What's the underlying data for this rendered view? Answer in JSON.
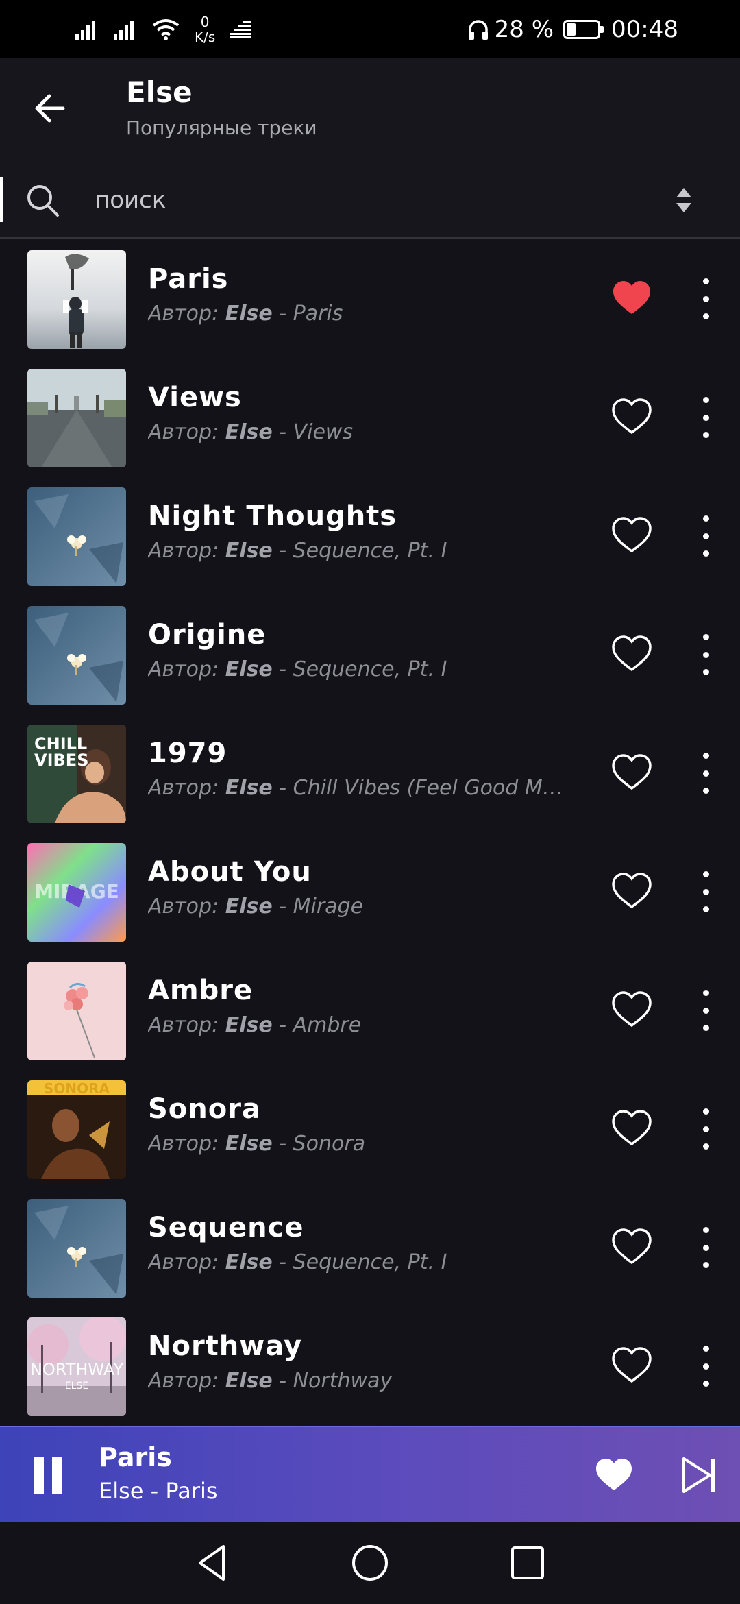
{
  "status_bar": {
    "net_speed_value": "0",
    "net_speed_unit": "K/s",
    "battery_percent": "28 %",
    "battery_level": 0.28,
    "time": "00:48"
  },
  "header": {
    "title": "Else",
    "subtitle": "Популярные треки"
  },
  "search": {
    "placeholder": "поиск"
  },
  "tracks": [
    {
      "title": "Paris",
      "author_label": "Автор: ",
      "artist": "Else",
      "album": " - Paris",
      "liked": true
    },
    {
      "title": "Views",
      "author_label": "Автор: ",
      "artist": "Else",
      "album": " - Views",
      "liked": false
    },
    {
      "title": "Night Thoughts",
      "author_label": "Автор: ",
      "artist": "Else",
      "album": " - Sequence, Pt. I",
      "liked": false
    },
    {
      "title": "Origine",
      "author_label": "Автор: ",
      "artist": "Else",
      "album": " - Sequence, Pt. I",
      "liked": false
    },
    {
      "title": "1979",
      "author_label": "Автор: ",
      "artist": "Else",
      "album": " - Chill Vibes (Feel Good Music)",
      "liked": false
    },
    {
      "title": "About You",
      "author_label": "Автор: ",
      "artist": "Else",
      "album": " - Mirage",
      "liked": false
    },
    {
      "title": "Ambre",
      "author_label": "Автор: ",
      "artist": "Else",
      "album": " - Ambre",
      "liked": false
    },
    {
      "title": "Sonora",
      "author_label": "Автор: ",
      "artist": "Else",
      "album": " - Sonora",
      "liked": false
    },
    {
      "title": "Sequence",
      "author_label": "Автор: ",
      "artist": "Else",
      "album": " - Sequence, Pt. I",
      "liked": false
    },
    {
      "title": "Northway",
      "author_label": "Автор: ",
      "artist": "Else",
      "album": " - Northway",
      "liked": false
    }
  ],
  "covers": {
    "chill_vibes_text_1": "CHILL",
    "chill_vibes_text_2": "VIBES",
    "mirage_text": "MIRAGE",
    "sonora_text": "SONORA",
    "northway_text": "NORTHWAY",
    "northway_sub": "ELSE"
  },
  "player": {
    "title": "Paris",
    "subtitle": "Else - Paris",
    "liked": true
  },
  "colors": {
    "background": "#121218",
    "heart_active": "#f0454f",
    "player_gradient_start": "#3d43b8",
    "player_gradient_end": "#6e4fb4"
  }
}
